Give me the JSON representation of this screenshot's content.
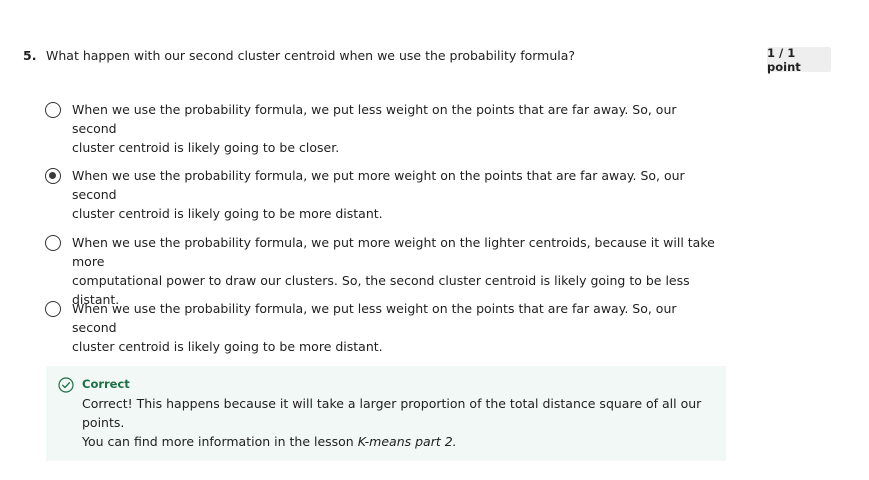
{
  "question": {
    "number": "5.",
    "text": "What happen with our second cluster centroid when we use the probability formula?",
    "score": "1 / 1 point"
  },
  "options": [
    {
      "line1": "When we use the probability formula, we put less weight on the points that are far away. So, our second",
      "line2": "cluster centroid is likely going to be closer.",
      "selected": false
    },
    {
      "line1": "When we use the probability formula, we put more weight on the points that are far away. So, our second",
      "line2": "cluster centroid is likely going to be more distant.",
      "selected": true
    },
    {
      "line1": "When we use the probability formula, we put more weight on the lighter centroids, because it will take more",
      "line2": "computational power to draw our clusters. So, the second cluster centroid is likely going to be less distant.",
      "selected": false
    },
    {
      "line1": "When we use the probability formula, we put less weight on the points that are far away. So, our second",
      "line2": "cluster centroid is likely going to be more distant.",
      "selected": false
    }
  ],
  "feedback": {
    "status": "Correct",
    "line1": "Correct! This happens because it will take a larger proportion of the total distance square of all our points.",
    "line2_prefix": "You can find more information in the lesson ",
    "line2_lesson": "K-means part 2.",
    "icon": "check-circle-icon",
    "accent_color": "#1d7046",
    "background_color": "#f2f8f5"
  }
}
